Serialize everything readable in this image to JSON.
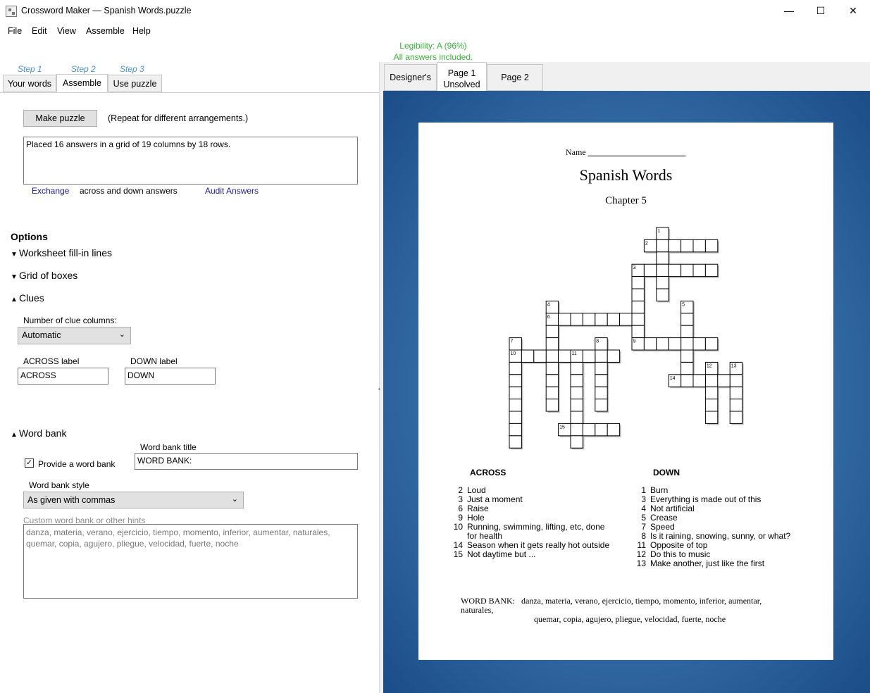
{
  "window": {
    "title": "Crossword Maker — Spanish Words.puzzle",
    "min": "—",
    "max": "☐",
    "close": "✕"
  },
  "menu": [
    "File",
    "Edit",
    "View",
    "Assemble",
    "Help"
  ],
  "status": {
    "legibility": "Legibility: A (96%)",
    "answers": "All answers included."
  },
  "left": {
    "steps": [
      "Step 1",
      "Step 2",
      "Step 3"
    ],
    "tabs": [
      "Your words",
      "Assemble",
      "Use puzzle"
    ],
    "make_button": "Make puzzle",
    "repeat_note": "(Repeat for different arrangements.)",
    "placed_text": "Placed  16 answers in a grid of 19 columns by 18 rows.",
    "exchange_link": "Exchange",
    "exchange_note": "across and down answers",
    "audit_link": "Audit Answers",
    "options_heading": "Options",
    "sections": {
      "worksheet": "Worksheet fill-in lines",
      "grid": "Grid of boxes",
      "clues": "Clues",
      "wordbank": "Word bank"
    },
    "clue_columns_label": "Number of clue columns:",
    "clue_columns_value": "Automatic",
    "across_label_caption": "ACROSS label",
    "across_label_value": "ACROSS",
    "down_label_caption": "DOWN label",
    "down_label_value": "DOWN",
    "provide_wordbank": "Provide a word bank",
    "wordbank_title_caption": "Word bank title",
    "wordbank_title_value": "WORD BANK:",
    "wordbank_style_caption": "Word bank style",
    "wordbank_style_value": "As given with commas",
    "custom_caption": "Custom word bank or other hints",
    "custom_value": "danza, materia, verano, ejercicio, tiempo, momento, inferior, aumentar, naturales, quemar, copia, agujero, pliegue, velocidad, fuerte, noche"
  },
  "right_tabs": [
    {
      "line1": "Designer's",
      "line2": ""
    },
    {
      "line1": "Page 1",
      "line2": "Unsolved"
    },
    {
      "line1": "Page 2",
      "line2": ""
    }
  ],
  "puzzle": {
    "name_label": "Name",
    "title": "Spanish Words",
    "subtitle": "Chapter 5",
    "across_heading": "ACROSS",
    "down_heading": "DOWN",
    "across": [
      {
        "n": "2",
        "t": "Loud"
      },
      {
        "n": "3",
        "t": "Just a moment"
      },
      {
        "n": "6",
        "t": "Raise"
      },
      {
        "n": "9",
        "t": "Hole"
      },
      {
        "n": "10",
        "t": "Running, swimming, lifting, etc, done"
      },
      {
        "n": "",
        "t": "for health"
      },
      {
        "n": "14",
        "t": "Season when it gets really hot outside"
      },
      {
        "n": "15",
        "t": "Not daytime but ..."
      }
    ],
    "down": [
      {
        "n": "1",
        "t": "Burn"
      },
      {
        "n": "3",
        "t": "Everything is made out of this"
      },
      {
        "n": "4",
        "t": "Not artificial"
      },
      {
        "n": "5",
        "t": "Crease"
      },
      {
        "n": "7",
        "t": "Speed"
      },
      {
        "n": "8",
        "t": "Is it raining, snowing, sunny, or what?"
      },
      {
        "n": "11",
        "t": "Opposite of top"
      },
      {
        "n": "12",
        "t": "Do this to music"
      },
      {
        "n": "13",
        "t": "Make another, just like the first"
      }
    ],
    "wordbank_label": "WORD BANK:",
    "wordbank_line1": "danza, materia, verano, ejercicio, tiempo, momento, inferior, aumentar, naturales,",
    "wordbank_line2": "quemar, copia, agujero, pliegue, velocidad, fuerte, noche",
    "grid": {
      "cols": 19,
      "rows": 18,
      "words": [
        {
          "n": "1",
          "dir": "down",
          "row": 0,
          "col": 12,
          "len": 6
        },
        {
          "n": "2",
          "dir": "across",
          "row": 1,
          "col": 11,
          "len": 6
        },
        {
          "n": "3",
          "dir": "across",
          "row": 3,
          "col": 10,
          "len": 7
        },
        {
          "n": "3",
          "dir": "down",
          "row": 3,
          "col": 10,
          "len": 6
        },
        {
          "n": "4",
          "dir": "down",
          "row": 6,
          "col": 3,
          "len": 9
        },
        {
          "n": "5",
          "dir": "down",
          "row": 6,
          "col": 14,
          "len": 7
        },
        {
          "n": "6",
          "dir": "across",
          "row": 7,
          "col": 3,
          "len": 8
        },
        {
          "n": "7",
          "dir": "down",
          "row": 9,
          "col": 0,
          "len": 9
        },
        {
          "n": "8",
          "dir": "down",
          "row": 9,
          "col": 7,
          "len": 6
        },
        {
          "n": "9",
          "dir": "across",
          "row": 9,
          "col": 10,
          "len": 7
        },
        {
          "n": "10",
          "dir": "across",
          "row": 10,
          "col": 0,
          "len": 9
        },
        {
          "n": "11",
          "dir": "down",
          "row": 10,
          "col": 5,
          "len": 8
        },
        {
          "n": "12",
          "dir": "down",
          "row": 11,
          "col": 16,
          "len": 5
        },
        {
          "n": "13",
          "dir": "down",
          "row": 11,
          "col": 18,
          "len": 5
        },
        {
          "n": "14",
          "dir": "across",
          "row": 12,
          "col": 13,
          "len": 6
        },
        {
          "n": "15",
          "dir": "across",
          "row": 16,
          "col": 4,
          "len": 5
        }
      ]
    }
  }
}
